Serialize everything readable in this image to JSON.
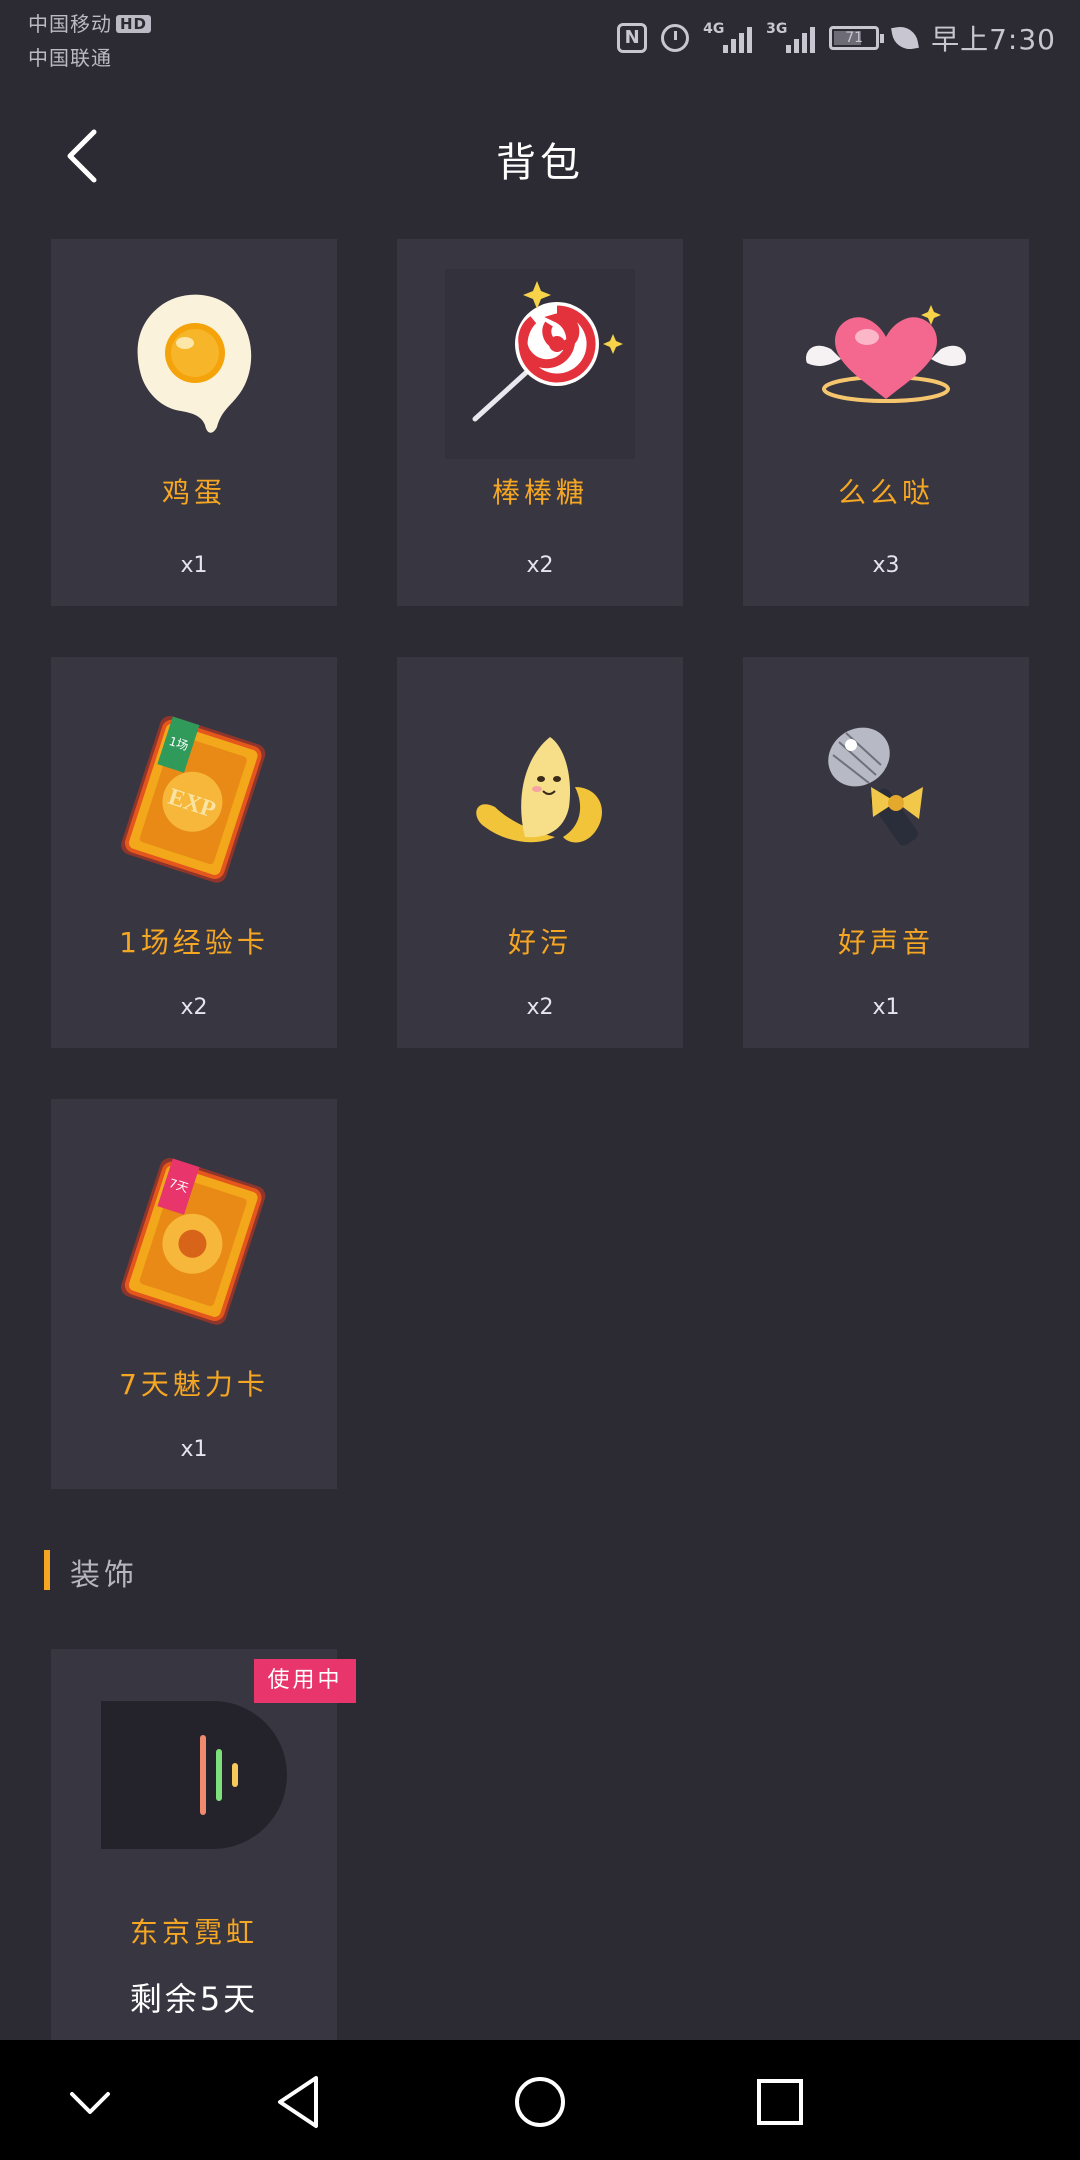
{
  "status_bar": {
    "carrier_1": "中国移动",
    "carrier_1_badge": "HD",
    "carrier_2": "中国联通",
    "nfc": "N",
    "network_1": "4G",
    "network_2": "3G",
    "battery": "71",
    "time": "早上7:30"
  },
  "header": {
    "title": "背包"
  },
  "items": [
    {
      "name": "鸡蛋",
      "count": "x1",
      "icon": "fried-egg-icon"
    },
    {
      "name": "棒棒糖",
      "count": "x2",
      "icon": "lollipop-icon"
    },
    {
      "name": "么么哒",
      "count": "x3",
      "icon": "winged-heart-icon"
    },
    {
      "name": "1场经验卡",
      "count": "x2",
      "icon": "exp-card-icon",
      "card_tag": "1场",
      "card_text": "EXP"
    },
    {
      "name": "好污",
      "count": "x2",
      "icon": "banana-icon"
    },
    {
      "name": "好声音",
      "count": "x1",
      "icon": "microphone-icon"
    },
    {
      "name": "7天魅力卡",
      "count": "x1",
      "icon": "charm-card-icon",
      "card_tag": "7天"
    }
  ],
  "decoration_section": {
    "title": "装饰",
    "item": {
      "name": "东京霓虹",
      "badge": "使用中",
      "remaining": "剩余5天"
    }
  },
  "colors": {
    "background": "#2c2a33",
    "card": "#383641",
    "accent": "#f5a623",
    "badge": "#e8356b"
  }
}
